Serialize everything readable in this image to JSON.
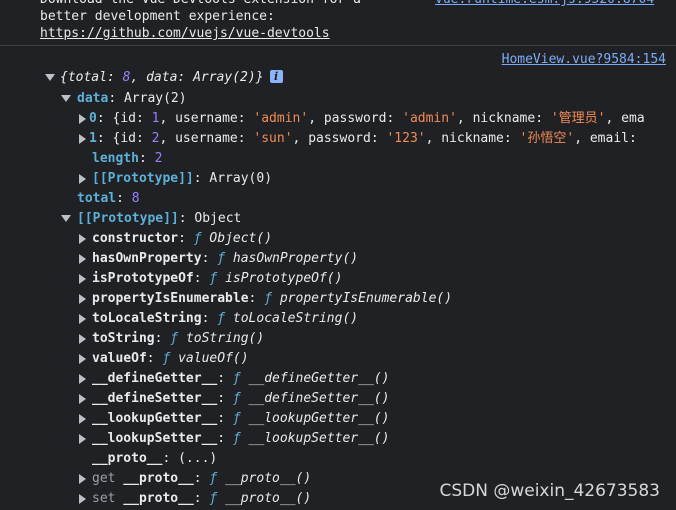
{
  "top_message": {
    "line1": "Download the Vue Devtools extension for a",
    "line2": "better development experience:",
    "link": "https://github.com/vuejs/vue-devtools",
    "source": "vue.runtime.esm.js:9520:8704"
  },
  "log_source": "HomeView.vue?9584:154",
  "root": {
    "summary_prefix": "{",
    "k_total": "total",
    "v_total": "8",
    "k_data": "data",
    "v_data": "Array(2)",
    "summary_suffix": "}"
  },
  "data_node": {
    "key": "data",
    "value": "Array(2)"
  },
  "items": [
    {
      "index": "0",
      "id": "1",
      "username": "'admin'",
      "password": "'admin'",
      "nickname": "'管理员'",
      "tail": "ema"
    },
    {
      "index": "1",
      "id": "2",
      "username": "'sun'",
      "password": "'123'",
      "nickname": "'孙悟空'",
      "tail": "email:"
    }
  ],
  "labels": {
    "id": "id",
    "username": "username",
    "password": "password",
    "nickname": "nickname",
    "length": "length",
    "total": "total",
    "prototype": "[[Prototype]]",
    "array0": "Array(0)",
    "object": "Object",
    "f": "ƒ"
  },
  "values": {
    "length": "2",
    "total": "8"
  },
  "proto_methods": [
    {
      "key": "constructor",
      "fn": "Object()"
    },
    {
      "key": "hasOwnProperty",
      "fn": "hasOwnProperty()"
    },
    {
      "key": "isPrototypeOf",
      "fn": "isPrototypeOf()"
    },
    {
      "key": "propertyIsEnumerable",
      "fn": "propertyIsEnumerable()"
    },
    {
      "key": "toLocaleString",
      "fn": "toLocaleString()"
    },
    {
      "key": "toString",
      "fn": "toString()"
    },
    {
      "key": "valueOf",
      "fn": "valueOf()"
    },
    {
      "key": "__defineGetter__",
      "fn": "__defineGetter__()"
    },
    {
      "key": "__defineSetter__",
      "fn": "__defineSetter__()"
    },
    {
      "key": "__lookupGetter__",
      "fn": "__lookupGetter__()"
    },
    {
      "key": "__lookupSetter__",
      "fn": "__lookupSetter__()"
    }
  ],
  "proto_accessor": {
    "key": "__proto__",
    "value": "(...)"
  },
  "accessors": [
    {
      "prefix": "get",
      "key": "__proto__",
      "fn": "__proto__()"
    },
    {
      "prefix": "set",
      "key": "__proto__",
      "fn": "__proto__()"
    }
  ],
  "watermark": "CSDN @weixin_42673583",
  "icons": {
    "info": "info-icon",
    "expand": "expand-arrow-icon",
    "collapse": "collapse-arrow-icon"
  },
  "colors": {
    "background": "#202124",
    "key": "#5db0d7",
    "string": "#f28b54",
    "number": "#9980ff",
    "link": "#7cacf8"
  }
}
